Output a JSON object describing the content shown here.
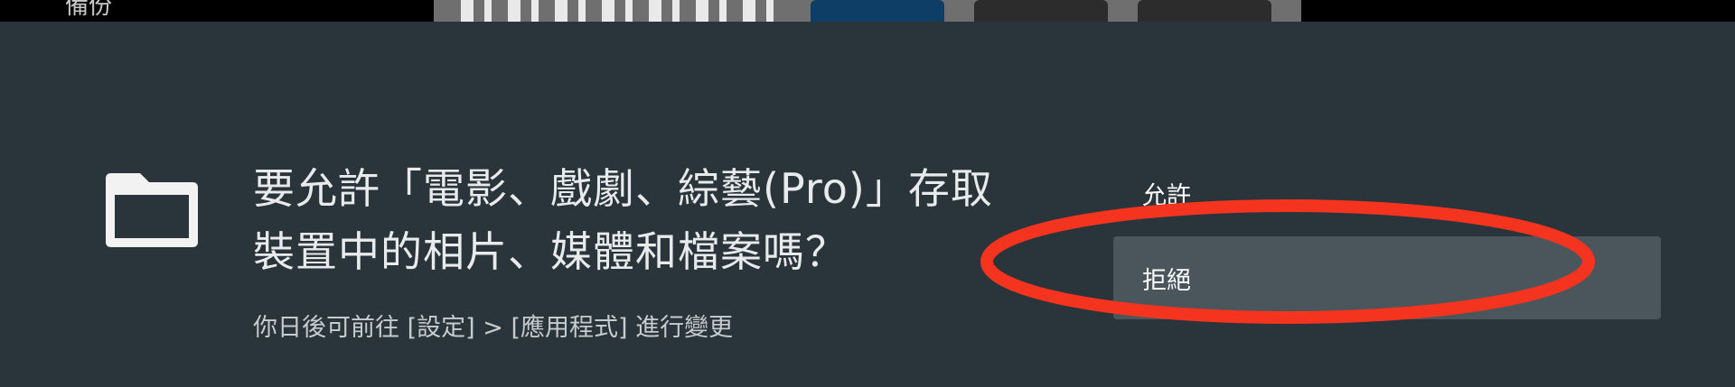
{
  "background_app": {
    "top_left_label": "備份"
  },
  "dialog": {
    "icon": "folder-icon",
    "title": "要允許「電影、戲劇、綜藝(Pro)」存取裝置中的相片、媒體和檔案嗎？",
    "subtitle": "你日後可前往 [設定] > [應用程式] 進行變更",
    "options": {
      "allow": "允許",
      "deny": "拒絕"
    }
  },
  "colors": {
    "dialog_background": "#2a343b",
    "selected_option_background": "#4b565c",
    "annotation_circle": "#f4341f"
  }
}
